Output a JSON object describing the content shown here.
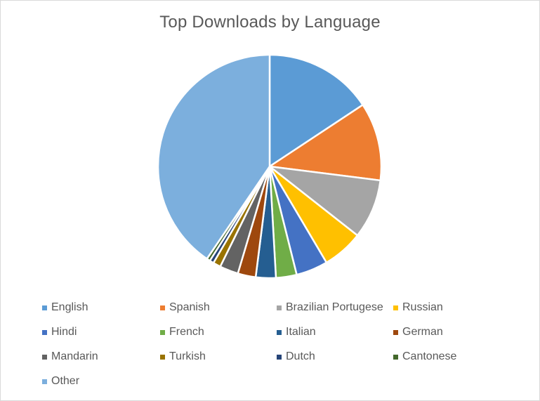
{
  "chart_data": {
    "type": "pie",
    "title": "Top Downloads by Language",
    "start_angle_deg": 0,
    "direction": "clockwise",
    "legend_position": "bottom",
    "unit": "percent (estimated from slice angles)",
    "slices": [
      {
        "label": "English",
        "value": 15.7,
        "color": "#5b9bd5"
      },
      {
        "label": "Spanish",
        "value": 11.3,
        "color": "#ed7d31"
      },
      {
        "label": "Brazilian Portugese",
        "value": 8.6,
        "color": "#a5a5a5"
      },
      {
        "label": "Russian",
        "value": 5.9,
        "color": "#ffc000"
      },
      {
        "label": "Hindi",
        "value": 4.6,
        "color": "#4472c4"
      },
      {
        "label": "French",
        "value": 3.0,
        "color": "#70ad47"
      },
      {
        "label": "Italian",
        "value": 2.9,
        "color": "#255e91"
      },
      {
        "label": "German",
        "value": 2.6,
        "color": "#9e480e"
      },
      {
        "label": "Mandarin",
        "value": 2.7,
        "color": "#636363"
      },
      {
        "label": "Turkish",
        "value": 1.1,
        "color": "#997300"
      },
      {
        "label": "Dutch",
        "value": 0.6,
        "color": "#264478"
      },
      {
        "label": "Cantonese",
        "value": 0.5,
        "color": "#43682b"
      },
      {
        "label": "Other",
        "value": 40.5,
        "color": "#7cafdd"
      }
    ]
  }
}
